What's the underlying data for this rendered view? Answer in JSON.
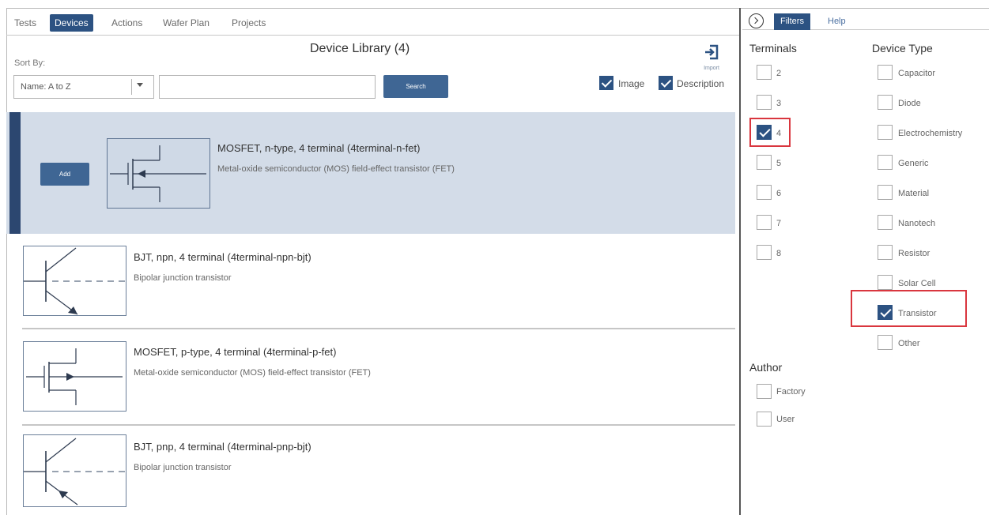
{
  "tabs": [
    {
      "label": "Tests",
      "active": false
    },
    {
      "label": "Devices",
      "active": true
    },
    {
      "label": "Actions",
      "active": false
    },
    {
      "label": "Wafer Plan",
      "active": false
    },
    {
      "label": "Projects",
      "active": false
    }
  ],
  "library": {
    "title": "Device Library (4)",
    "sort_label": "Sort By:",
    "sort_value": "Name: A to Z",
    "search_value": "",
    "search_button": "Search",
    "import_label": "Import",
    "image_label": "Image",
    "image_checked": true,
    "description_label": "Description",
    "description_checked": true
  },
  "devices": [
    {
      "title": "MOSFET, n-type, 4 terminal (4terminal-n-fet)",
      "description": "Metal-oxide semiconductor (MOS) field-effect transistor (FET)",
      "selected": true,
      "add_label": "Add",
      "symbol": "nmos-icon"
    },
    {
      "title": "BJT, npn, 4 terminal (4terminal-npn-bjt)",
      "description": "Bipolar junction transistor",
      "selected": false,
      "symbol": "npn-icon"
    },
    {
      "title": "MOSFET, p-type, 4 terminal (4terminal-p-fet)",
      "description": "Metal-oxide semiconductor (MOS) field-effect transistor (FET)",
      "selected": false,
      "symbol": "pmos-icon"
    },
    {
      "title": "BJT, pnp, 4 terminal (4terminal-pnp-bjt)",
      "description": "Bipolar junction transistor",
      "selected": false,
      "symbol": "pnp-icon"
    }
  ],
  "panel": {
    "tabs": [
      {
        "label": "Filters",
        "active": true
      },
      {
        "label": "Help",
        "active": false
      }
    ],
    "terminals_heading": "Terminals",
    "terminals": [
      {
        "label": "2",
        "checked": false
      },
      {
        "label": "3",
        "checked": false
      },
      {
        "label": "4",
        "checked": true
      },
      {
        "label": "5",
        "checked": false
      },
      {
        "label": "6",
        "checked": false
      },
      {
        "label": "7",
        "checked": false
      },
      {
        "label": "8",
        "checked": false
      }
    ],
    "device_type_heading": "Device Type",
    "device_types": [
      {
        "label": "Capacitor",
        "checked": false
      },
      {
        "label": "Diode",
        "checked": false
      },
      {
        "label": "Electrochemistry",
        "checked": false
      },
      {
        "label": "Generic",
        "checked": false
      },
      {
        "label": "Material",
        "checked": false
      },
      {
        "label": "Nanotech",
        "checked": false
      },
      {
        "label": "Resistor",
        "checked": false
      },
      {
        "label": "Solar Cell",
        "checked": false
      },
      {
        "label": "Transistor",
        "checked": true
      },
      {
        "label": "Other",
        "checked": false
      }
    ],
    "author_heading": "Author",
    "authors": [
      {
        "label": "Factory",
        "checked": false
      },
      {
        "label": "User",
        "checked": false
      }
    ]
  },
  "colors": {
    "accent": "#2c5282",
    "button": "#3f6694",
    "selected_row": "#d3dce8",
    "highlight": "#d9363e"
  }
}
